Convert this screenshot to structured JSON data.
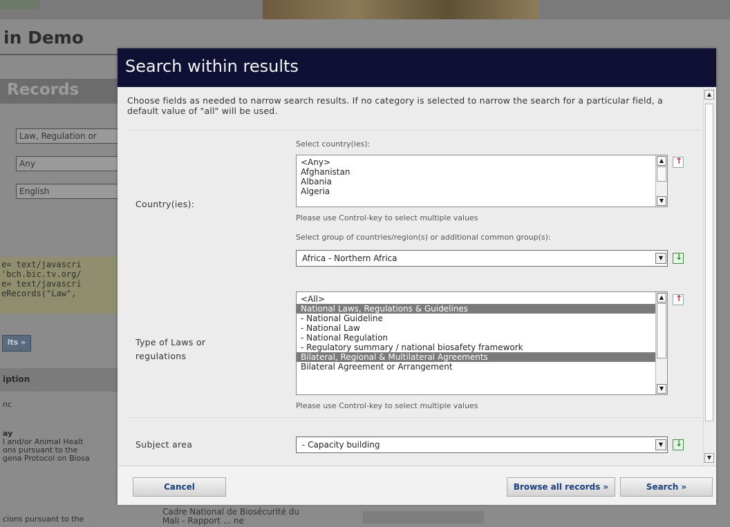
{
  "background": {
    "page_title": "in Demo",
    "section_title": "Records",
    "fields": [
      "Law, Regulation or",
      "Any",
      "English"
    ],
    "code_lines": [
      "e= text/javascri",
      "'bch.bic.tv.org/",
      "e= text/javascri",
      "eRecords(\"Law\","
    ],
    "button_label": "lts »",
    "option_header": "iption",
    "option_value": "nc",
    "list_bold": "ay",
    "list_lines": [
      "l and/or Animal Healt",
      "ons pursuant to the",
      "gena Protocol on Biosa"
    ],
    "bottom_left": "cions pursuant to the",
    "bottom_center_line1": "Cadre National de Biosécurité du",
    "bottom_center_line2": "Mali - Rapport ... ne"
  },
  "modal": {
    "title": "Search within results",
    "intro": "Choose fields as needed to narrow search results. If no category is selected to narrow the search for a particular field, a default value of \"all\" will be used.",
    "country": {
      "label": "Country(ies):",
      "select_hint": "Select country(ies):",
      "options": [
        "<Any>",
        "Afghanistan",
        "Albania",
        "Algeria"
      ],
      "ctrl_hint": "Please use Control-key to select multiple values",
      "group_hint": "Select group of countries/region(s) or additional common group(s):",
      "group_value": "Africa - Northern Africa"
    },
    "law_type": {
      "label_line1": "Type of Laws or",
      "label_line2": "regulations",
      "options": [
        {
          "text": "<All>",
          "selected": false
        },
        {
          "text": "National Laws, Regulations & Guidelines",
          "selected": true
        },
        {
          "text": " - National Guideline",
          "selected": false
        },
        {
          "text": " - National Law",
          "selected": false
        },
        {
          "text": " - National Regulation",
          "selected": false
        },
        {
          "text": " - Regulatory summary / national biosafety framework",
          "selected": false
        },
        {
          "text": "Bilateral, Regional & Multilateral Agreements",
          "selected": true
        },
        {
          "text": "   Bilateral Agreement or Arrangement",
          "selected": false
        }
      ],
      "ctrl_hint": "Please use Control-key to select multiple values"
    },
    "subject": {
      "label": "Subject area",
      "value": " - Capacity building"
    },
    "buttons": {
      "cancel": "Cancel",
      "browse": "Browse all records »",
      "search": "Search »"
    }
  },
  "icons": {
    "reset": "reset-arrow-icon",
    "add": "add-arrow-icon",
    "scroll_up": "scroll-up-icon",
    "scroll_down": "scroll-down-icon",
    "dropdown": "chevron-down-icon"
  }
}
